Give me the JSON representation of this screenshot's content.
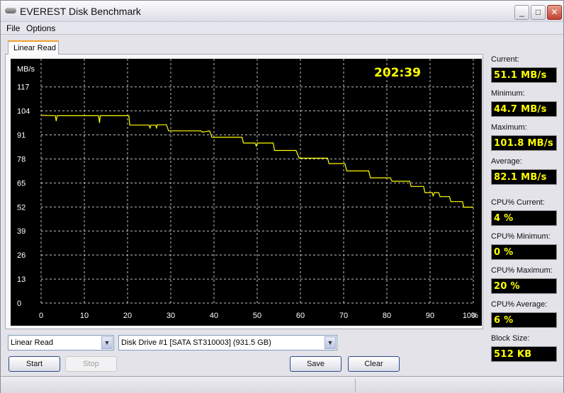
{
  "window": {
    "title": "EVEREST Disk Benchmark",
    "minimize": "_",
    "maximize": "□",
    "close": "✕"
  },
  "menu": [
    "File",
    "Options"
  ],
  "tab": "Linear Read",
  "stats": [
    {
      "label": "Current:",
      "value": "51.1 MB/s"
    },
    {
      "label": "Minimum:",
      "value": "44.7 MB/s"
    },
    {
      "label": "Maximum:",
      "value": "101.8 MB/s"
    },
    {
      "label": "Average:",
      "value": "82.1 MB/s"
    },
    {
      "label": "CPU% Current:",
      "value": "4 %"
    },
    {
      "label": "CPU% Minimum:",
      "value": "0 %"
    },
    {
      "label": "CPU% Maximum:",
      "value": "20 %"
    },
    {
      "label": "CPU% Average:",
      "value": "6 %"
    },
    {
      "label": "Block Size:",
      "value": "512 KB"
    }
  ],
  "controls": {
    "test_select": "Linear Read",
    "drive_select": "Disk Drive #1  [SATA ST310003]  (931.5 GB)",
    "start": "Start",
    "stop": "Stop",
    "save": "Save",
    "clear": "Clear"
  },
  "chart_data": {
    "type": "line",
    "timer": "202:39",
    "ylabel": "MB/s",
    "xlabel": "%",
    "ylim": [
      0,
      117
    ],
    "xlim": [
      0,
      100
    ],
    "yticks": [
      "0",
      "13",
      "26",
      "39",
      "52",
      "65",
      "78",
      "91",
      "104",
      "117"
    ],
    "xticks": [
      "0",
      "10",
      "20",
      "30",
      "40",
      "50",
      "60",
      "70",
      "80",
      "90",
      "100"
    ],
    "line_color": "#ffff00",
    "series": [
      {
        "name": "Linear Read",
        "points": [
          [
            0,
            101.6
          ],
          [
            3.3,
            101.4
          ],
          [
            3.5,
            98.5
          ],
          [
            3.7,
            101.4
          ],
          [
            13.3,
            101.4
          ],
          [
            13.5,
            97.5
          ],
          [
            13.7,
            101.4
          ],
          [
            20.3,
            101.4
          ],
          [
            20.5,
            96.3
          ],
          [
            25,
            96.3
          ],
          [
            25.2,
            94.5
          ],
          [
            25.4,
            96.3
          ],
          [
            26.5,
            96.3
          ],
          [
            26.7,
            94.8
          ],
          [
            26.9,
            96.5
          ],
          [
            29,
            96.5
          ],
          [
            29.5,
            93.2
          ],
          [
            37,
            93.2
          ],
          [
            37.3,
            92.5
          ],
          [
            39,
            93.2
          ],
          [
            39.5,
            89.7
          ],
          [
            46.5,
            89.7
          ],
          [
            46.8,
            86.6
          ],
          [
            49.5,
            86.6
          ],
          [
            49.8,
            85
          ],
          [
            50,
            86.6
          ],
          [
            53.7,
            86.6
          ],
          [
            54,
            82.6
          ],
          [
            59,
            82.6
          ],
          [
            59.7,
            78.4
          ],
          [
            66.3,
            78.4
          ],
          [
            66.6,
            75.5
          ],
          [
            70.3,
            75.5
          ],
          [
            70.7,
            71.5
          ],
          [
            75.8,
            71.5
          ],
          [
            76.2,
            67.8
          ],
          [
            80.8,
            67.8
          ],
          [
            81.2,
            65.9
          ],
          [
            85.3,
            65.9
          ],
          [
            85.6,
            63.1
          ],
          [
            88.5,
            63.1
          ],
          [
            88.8,
            59.8
          ],
          [
            90.5,
            59.8
          ],
          [
            90.7,
            58
          ],
          [
            91,
            59.8
          ],
          [
            92,
            59.8
          ],
          [
            92.3,
            57.6
          ],
          [
            94.5,
            57.6
          ],
          [
            94.8,
            54.9
          ],
          [
            97.5,
            54.9
          ],
          [
            97.8,
            51.9
          ],
          [
            100,
            51.9
          ]
        ]
      }
    ]
  }
}
